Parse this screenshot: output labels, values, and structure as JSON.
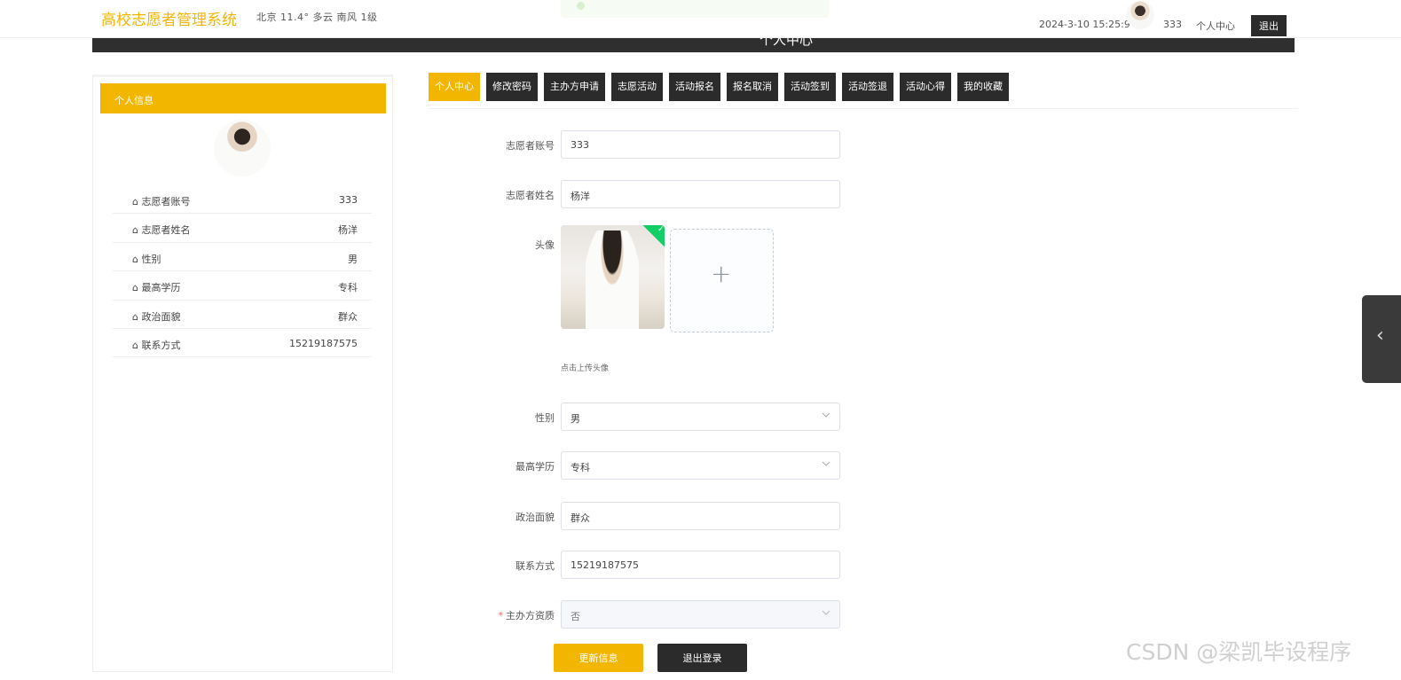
{
  "header": {
    "brand": "高校志愿者管理系统",
    "weather": "北京  11.4°  多云  南风  1级",
    "datetime": "2024-3-10 15:25:9",
    "username": "333",
    "personal_center": "个人中心",
    "logout": "退出"
  },
  "banner": {
    "title": "个人中心"
  },
  "left_panel": {
    "title": "个人信息",
    "rows": [
      {
        "label": "志愿者账号",
        "value": "333"
      },
      {
        "label": "志愿者姓名",
        "value": "杨洋"
      },
      {
        "label": "性别",
        "value": "男"
      },
      {
        "label": "最高学历",
        "value": "专科"
      },
      {
        "label": "政治面貌",
        "value": "群众"
      },
      {
        "label": "联系方式",
        "value": "15219187575"
      }
    ]
  },
  "tabs": [
    "个人中心",
    "修改密码",
    "主办方申请",
    "志愿活动",
    "活动报名",
    "报名取消",
    "活动签到",
    "活动签退",
    "活动心得",
    "我的收藏"
  ],
  "form": {
    "account_label": "志愿者账号",
    "account_value": "333",
    "name_label": "志愿者姓名",
    "name_value": "杨洋",
    "avatar_label": "头像",
    "avatar_hint": "点击上传头像",
    "gender_label": "性别",
    "gender_value": "男",
    "education_label": "最高学历",
    "education_value": "专科",
    "political_label": "政治面貌",
    "political_value": "群众",
    "phone_label": "联系方式",
    "phone_value": "15219187575",
    "host_label": "主办方资质",
    "host_value": "否",
    "update_button": "更新信息",
    "logout_button": "退出登录"
  },
  "icons": {
    "check": "✓",
    "plus": "+",
    "chevron_left": "‹",
    "home": "⌂"
  },
  "watermark": "CSDN @梁凯毕设程序",
  "colors": {
    "accent": "#f3b600",
    "dark": "#2b2b2b",
    "success": "#13ce66"
  }
}
